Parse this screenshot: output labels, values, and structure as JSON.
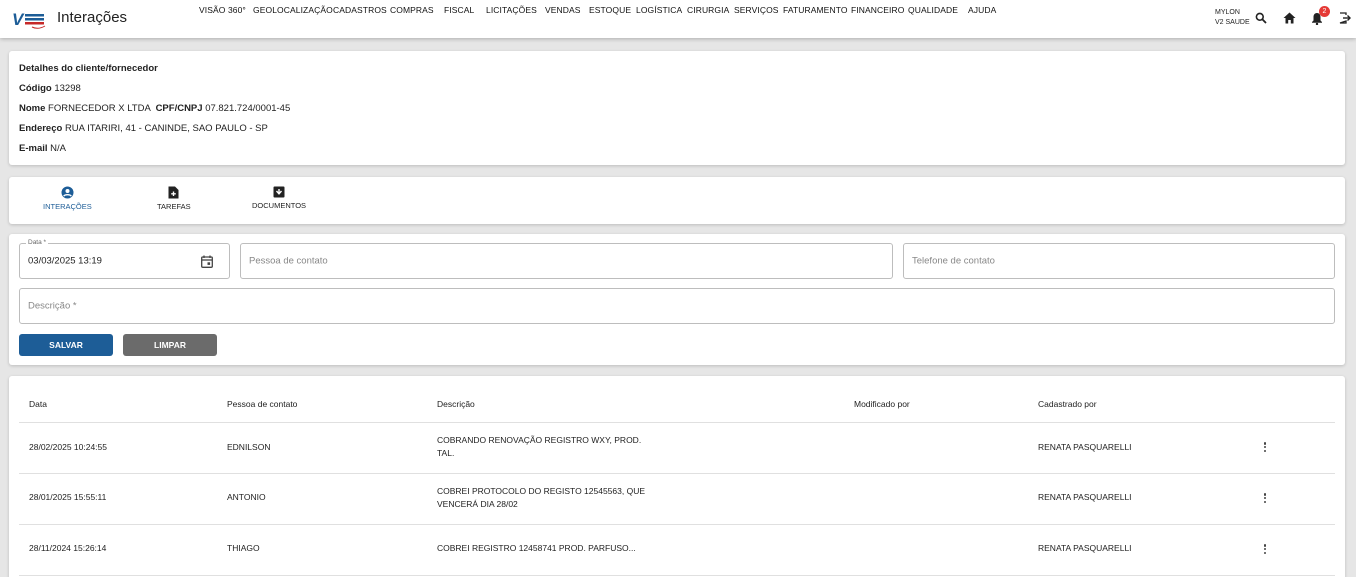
{
  "app": {
    "logo_text": "V2",
    "title": "Interações"
  },
  "menu": [
    "VISÃO 360°",
    "GEOLOCALIZAÇÃO",
    "CADASTROS",
    "COMPRAS",
    "FISCAL",
    "LICITAÇÕES",
    "VENDAS",
    "ESTOQUE",
    "LOGÍSTICA",
    "CIRURGIA",
    "SERVIÇOS",
    "FATURAMENTO",
    "FINANCEIRO",
    "QUALIDADE",
    "AJUDA"
  ],
  "user": {
    "name": "MYLON",
    "company": "V2 SAUDE",
    "notifications": "2"
  },
  "details": {
    "heading": "Detalhes do cliente/fornecedor",
    "code_label": "Código",
    "code": "13298",
    "name_label": "Nome",
    "name": "FORNECEDOR X LTDA",
    "doc_label": "CPF/CNPJ",
    "doc": "07.821.724/0001-45",
    "address_label": "Endereço",
    "address": "RUA ITARIRI, 41 - CANINDE, SAO PAULO - SP",
    "email_label": "E-mail",
    "email": "N/A"
  },
  "tabs": [
    {
      "label": "INTERAÇÕES",
      "icon": "account-circle-icon"
    },
    {
      "label": "TAREFAS",
      "icon": "note-add-icon"
    },
    {
      "label": "DOCUMENTOS",
      "icon": "archive-icon"
    }
  ],
  "form": {
    "date_label": "Data *",
    "date_value": "03/03/2025 13:19",
    "contact_placeholder": "Pessoa de contato",
    "phone_placeholder": "Telefone de contato",
    "description_placeholder": "Descrição *",
    "save_label": "SALVAR",
    "clear_label": "LIMPAR"
  },
  "table": {
    "headers": [
      "Data",
      "Pessoa de contato",
      "Descrição",
      "Modificado por",
      "Cadastrado por"
    ],
    "rows": [
      {
        "date": "28/02/2025 10:24:55",
        "contact": "EDNILSON",
        "desc1": "COBRANDO RENOVAÇÃO REGISTRO WXY, PROD.",
        "desc2": "TAL.",
        "modified": "",
        "created": "RENATA PASQUARELLI"
      },
      {
        "date": "28/01/2025 15:55:11",
        "contact": "ANTONIO",
        "desc1": "COBREI PROTOCOLO DO REGISTO 12545563, QUE",
        "desc2": "VENCERÁ DIA 28/02",
        "modified": "",
        "created": "RENATA PASQUARELLI"
      },
      {
        "date": "28/11/2024 15:26:14",
        "contact": "THIAGO",
        "desc1": "COBREI REGISTRO 12458741 PROD. PARFUSO...",
        "desc2": "",
        "modified": "",
        "created": "RENATA PASQUARELLI"
      }
    ]
  },
  "colors": {
    "primary": "#1d5d97",
    "clear_button": "#6b6b6b",
    "badge": "#e53935"
  }
}
